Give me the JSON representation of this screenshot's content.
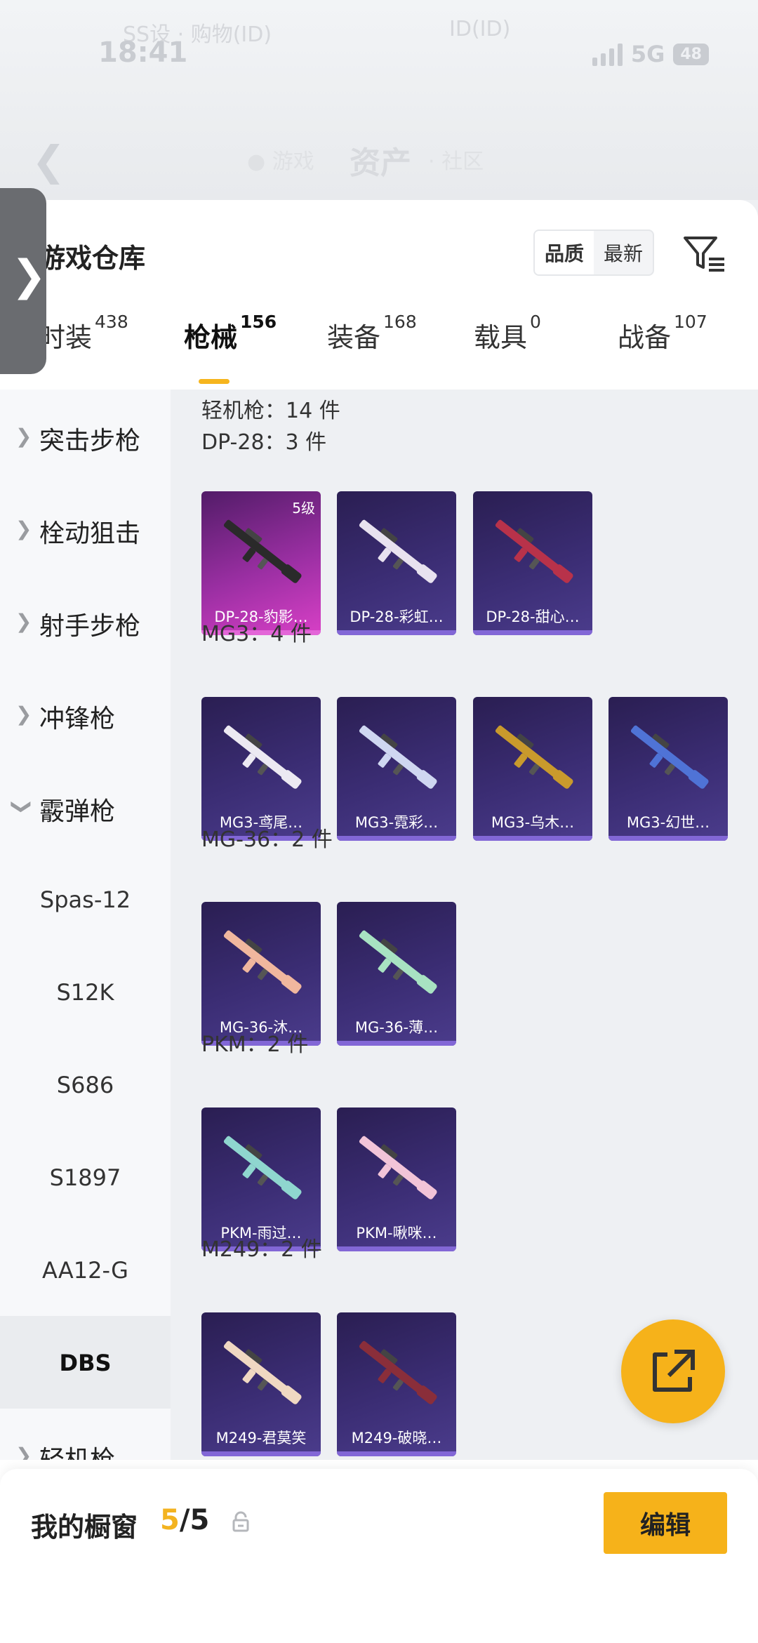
{
  "status_bar": {
    "time": "18:41",
    "ghost_left": "SS设 · 购物(ID)",
    "ghost_right": "ID(ID)",
    "network": "5G",
    "battery": "48"
  },
  "nav": {
    "title": "资产",
    "ghost_left": "● 游戏",
    "ghost_right": "· 社区"
  },
  "warehouse": {
    "title": "游戏仓库",
    "sort_options": [
      "品质",
      "最新"
    ],
    "active_sort": "品质"
  },
  "tabs": [
    {
      "label": "时装",
      "count": "438"
    },
    {
      "label": "枪械",
      "count": "156"
    },
    {
      "label": "装备",
      "count": "168"
    },
    {
      "label": "载具",
      "count": "0"
    },
    {
      "label": "战备",
      "count": "107"
    }
  ],
  "active_tab": "枪械",
  "categories": {
    "assault": "突击步枪",
    "bolt": "栓动狙击",
    "marksman": "射手步枪",
    "smg": "冲锋枪",
    "shotgun": "霰弹枪",
    "shotgun_subs": [
      "Spas-12",
      "S12K",
      "S686",
      "S1897",
      "AA12-G",
      "DBS"
    ],
    "selected_sub": "DBS",
    "lmg": "轻机枪"
  },
  "content": {
    "header": "轻机枪：14 件",
    "groups": [
      {
        "title": "DP-28：3 件",
        "items": [
          {
            "name": "DP-28-豹影…",
            "badge": "5级",
            "rarity": "pink",
            "color": "#2a2a2a"
          },
          {
            "name": "DP-28-彩虹…",
            "badge": "",
            "rarity": "purple",
            "color": "#e8e2ef"
          },
          {
            "name": "DP-28-甜心…",
            "badge": "",
            "rarity": "purple",
            "color": "#b8324a"
          }
        ]
      },
      {
        "title": "MG3：4 件",
        "items": [
          {
            "name": "MG3-鸢尾…",
            "badge": "",
            "rarity": "purple",
            "color": "#ece9f2"
          },
          {
            "name": "MG3-霓彩…",
            "badge": "",
            "rarity": "purple",
            "color": "#cfd7f1"
          },
          {
            "name": "MG3-乌木…",
            "badge": "",
            "rarity": "purple",
            "color": "#c99a2c"
          },
          {
            "name": "MG3-幻世…",
            "badge": "",
            "rarity": "purple",
            "color": "#4f73d6"
          }
        ]
      },
      {
        "title": "MG-36：2 件",
        "items": [
          {
            "name": "MG-36-沐…",
            "badge": "",
            "rarity": "purple",
            "color": "#f0b79e"
          },
          {
            "name": "MG-36-薄…",
            "badge": "",
            "rarity": "purple",
            "color": "#a8e2c2"
          }
        ]
      },
      {
        "title": "PKM：2 件",
        "items": [
          {
            "name": "PKM-雨过…",
            "badge": "",
            "rarity": "purple",
            "color": "#8fd6cf"
          },
          {
            "name": "PKM-啾咪…",
            "badge": "",
            "rarity": "purple",
            "color": "#f2c4d8"
          }
        ]
      },
      {
        "title": "M249：2 件",
        "items": [
          {
            "name": "M249-君莫笑",
            "badge": "",
            "rarity": "purple",
            "color": "#f0d8c2"
          },
          {
            "name": "M249-破晓…",
            "badge": "",
            "rarity": "purple",
            "color": "#8a2e3a"
          }
        ]
      }
    ]
  },
  "bottom": {
    "label": "我的橱窗",
    "current": "5",
    "total": "/5",
    "edit_label": "编辑"
  },
  "icons": {
    "back": "back-arrow-icon",
    "filter": "filter-icon",
    "share": "share-icon",
    "lock": "lock-icon",
    "expand": "chevron-right-icon"
  },
  "colors": {
    "accent": "#f6b21a",
    "item_purple": "#3b2d74",
    "item_pink": "#d840c6"
  }
}
